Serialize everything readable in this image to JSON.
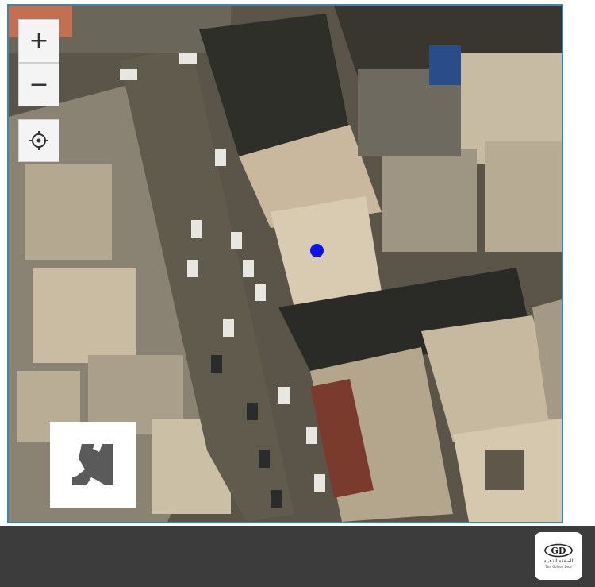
{
  "map": {
    "zoom_in_label": "+",
    "zoom_out_label": "−",
    "imagery": "satellite",
    "controls": [
      "zoom-in",
      "zoom-out",
      "locate-me",
      "layer-switcher"
    ],
    "marker_color": "#0a14e6",
    "frame_color": "#2e8db8"
  },
  "footer": {
    "background": "#3c3c3c",
    "logo_text_ar": "الصفقة الذهبية",
    "logo_text_en": "The Golden Deal"
  }
}
